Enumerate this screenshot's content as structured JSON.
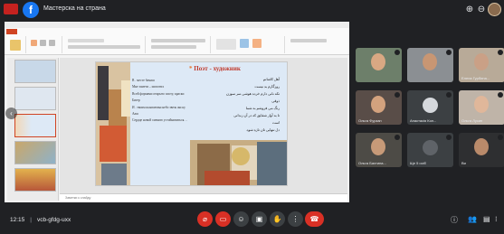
{
  "meeting": {
    "title": "Мастерска на страна",
    "code": "vcb-gfdg-uxx",
    "time": "12:15"
  },
  "slide": {
    "title": "Поэт - художник",
    "ru_lines": [
      "В . месте бамаш",
      "Мне замети – шопотих",
      "Всей формами открыто плоту, краски",
      "Бигер",
      "И . твоим шангаемъи небо звезь жи ку",
      "Ааш",
      "Сердце новой сменою устойновиться…"
    ],
    "fa_lines": [
      "آهل کاشانم",
      "روزگارم بد نیست",
      "تکه نانی دارم خرده هوشی سر سوزن",
      "ذوقی",
      "رنگ می فروشم به شما",
      "تا به آواز شقایق که در آن زندانی",
      "است",
      "دل تنهایی تان تازه شود."
    ],
    "notes_placeholder": "Заметки к слайду"
  },
  "participants": [
    {
      "name": ""
    },
    {
      "name": ""
    },
    {
      "name": "Елена Гурбина..."
    },
    {
      "name": "Ольга Фурзан"
    },
    {
      "name": "Анастасія Кол..."
    },
    {
      "name": "Ольга Лусин"
    },
    {
      "name": "Ольга Бахтина..."
    },
    {
      "name": "Ще 5 осіб"
    },
    {
      "name": "Ви"
    }
  ],
  "colors": {
    "meet_bg": "#202124",
    "tile_bg": "#3c4043",
    "hangup_red": "#d93025",
    "slide_title_red": "#c0392b",
    "ribbon_file": "#d04423"
  }
}
